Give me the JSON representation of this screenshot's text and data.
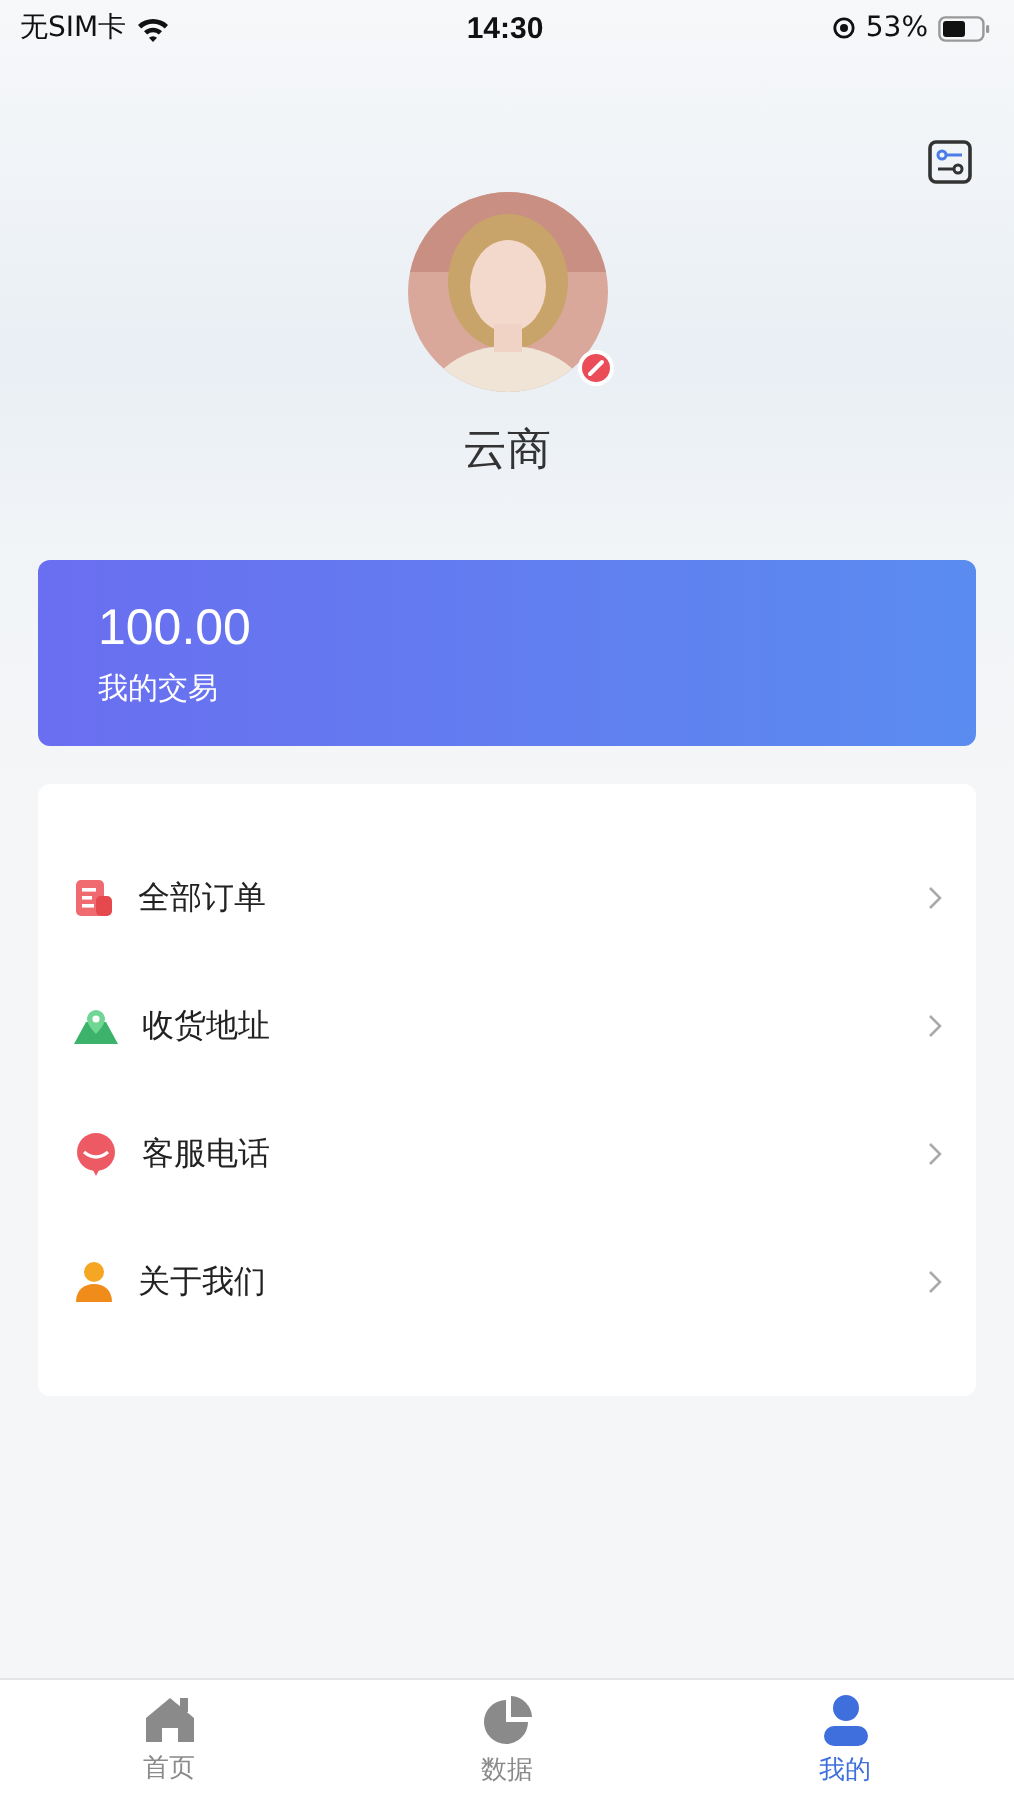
{
  "status_bar": {
    "carrier": "无SIM卡",
    "time": "14:30",
    "battery": "53%"
  },
  "profile": {
    "name": "云商"
  },
  "balance_card": {
    "amount": "100.00",
    "label": "我的交易"
  },
  "menu": [
    {
      "kind": "orders",
      "label": "全部订单"
    },
    {
      "kind": "address",
      "label": "收货地址"
    },
    {
      "kind": "service",
      "label": "客服电话"
    },
    {
      "kind": "about",
      "label": "关于我们"
    }
  ],
  "tab_bar": [
    {
      "kind": "home",
      "label": "首页",
      "selected": false
    },
    {
      "kind": "data",
      "label": "数据",
      "selected": false
    },
    {
      "kind": "mine",
      "label": "我的",
      "selected": true
    }
  ]
}
